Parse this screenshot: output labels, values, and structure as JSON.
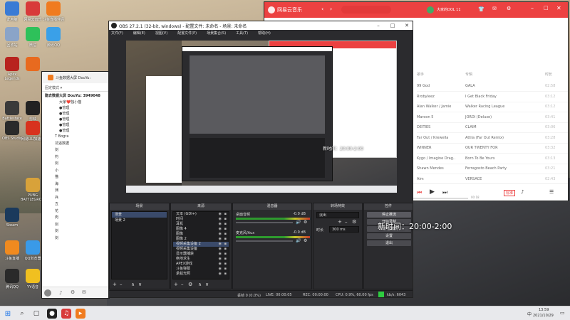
{
  "desktop": {
    "icons": [
      {
        "label": "此电脑",
        "icon": "computer-icon",
        "color": "#3a7bd5"
      },
      {
        "label": "网易云音乐",
        "icon": "netease-music-icon",
        "color": "#d83a3a"
      },
      {
        "label": "斗鱼直播伴侣",
        "icon": "douyu-icon",
        "color": "#f07b1f"
      },
      {
        "label": "回收站",
        "icon": "recycle-bin-icon",
        "color": "#8aa4c8"
      },
      {
        "label": "微信",
        "icon": "wechat-icon",
        "color": "#2ec15a"
      },
      {
        "label": "腾讯QQ",
        "icon": "qq-icon",
        "color": "#3aa0e8"
      },
      {
        "label": "Apex Legends",
        "icon": "apex-icon",
        "color": "#b8231e"
      },
      {
        "label": "",
        "icon": "app-icon",
        "color": "#e86a1f"
      },
      {
        "label": "Battlestate Games",
        "icon": "battlestate-icon",
        "color": "#3a3a3a"
      },
      {
        "label": "剪映",
        "icon": "jianying-icon",
        "color": "#222"
      },
      {
        "label": "OBS Studio",
        "icon": "obs-icon",
        "color": "#2a2a2a"
      },
      {
        "label": "网易UU加速器",
        "icon": "uu-icon",
        "color": "#d8321e"
      },
      {
        "label": "PUBG BATTLEGROUNDS",
        "icon": "pubg-icon",
        "color": "#d8a23a"
      },
      {
        "label": "Steam",
        "icon": "steam-icon",
        "color": "#1b3a5c"
      },
      {
        "label": "斗鱼直播",
        "icon": "douyu-live-icon",
        "color": "#f08a1f"
      },
      {
        "label": "QQ浏览器",
        "icon": "qq-browser-icon",
        "color": "#3a9ae8"
      },
      {
        "label": "腾讯QQ",
        "icon": "tencent-qq-icon",
        "color": "#2a2a2a"
      },
      {
        "label": "YY语音",
        "icon": "yy-icon",
        "color": "#f0c020"
      }
    ]
  },
  "douyu": {
    "title": "斗鱼数据大屏 DouYu:",
    "room_line": "隐去数据大屏 DouYu: 3949048",
    "items": [
      "大家❤️独小猫",
      "●管理",
      "●管理",
      "●管理",
      "●管理",
      "●管理"
    ],
    "list": [
      "T Bogra",
      "坑逼数据",
      "剑",
      "钓",
      "剑",
      "小",
      "猫",
      "海",
      "渊",
      "兵",
      "五",
      "花",
      "肉",
      "剑",
      "剑",
      "剑"
    ],
    "links": [
      "问问",
      "问问",
      "问问",
      "问问"
    ]
  },
  "obs": {
    "title": "OBS 27.2.1 (32-bit, windows) - 配置文件: 未命名 - 场景: 未命名",
    "menu": [
      "文件(F)",
      "编辑(E)",
      "视图(V)",
      "配置文件(P)",
      "场景集合(S)",
      "工具(T)",
      "帮助(H)"
    ],
    "scenes_header": "场景",
    "scenes": [
      "场景",
      "场景 2"
    ],
    "sources_header": "来源",
    "sources": [
      "文本 (GDI+)",
      "时间",
      "耳机",
      "图像 4",
      "图像",
      "图像 2",
      "视频采集设备 2",
      "视频采集设备",
      "显示器捕获",
      "绝地求生",
      "APEX游戏",
      "斗鱼弹幕",
      "承载光照"
    ],
    "mixer_header": "混音器",
    "mixer": [
      {
        "name": "桌面音频",
        "db": "-0.0 dB"
      },
      {
        "name": "麦克风/Aux",
        "db": "-0.0 dB"
      }
    ],
    "transitions_header": "转场特效",
    "transition": "淡出",
    "duration_label": "时长",
    "duration_value": "300 ms",
    "controls_header": "控件",
    "controls": [
      "停止推流",
      "开始录制",
      "工作室模式",
      "设置",
      "退出"
    ],
    "status": {
      "dropped": "丢帧 0 (0.0%)",
      "live": "LIVE: 00:00:05",
      "rec": "REC: 00:00:00",
      "cpu": "CPU: 0.9%, 60.00 fps",
      "kbps": "kb/s: 6043"
    }
  },
  "overlay_time": "新时间：20:00-2:00",
  "music": {
    "title": "网易云音乐",
    "user": "大家的DOL 11",
    "cols": [
      "歌手",
      "专辑",
      "时长"
    ],
    "rows": [
      {
        "song": "99 God",
        "artist": "",
        "album": "GALA",
        "dur": "02:58"
      },
      {
        "song": "",
        "artist": "Rrobyleez",
        "album": "I Get Black Friday",
        "dur": "03:12"
      },
      {
        "song": "",
        "artist": "Alan Walker / Jamie",
        "album": "Walker Racing League",
        "dur": "03:12"
      },
      {
        "song": "",
        "artist": "Maroon 5",
        "album": "JORDI (Deluxe)",
        "dur": "03:41"
      },
      {
        "song": "",
        "artist": "DEITIES",
        "album": "CLAIM",
        "dur": "03:06"
      },
      {
        "song": "",
        "artist": "Far Out / Krewella",
        "album": "Attila (Far Out Remix)",
        "dur": "03:28"
      },
      {
        "song": "",
        "artist": "WINNER",
        "album": "OUR TWENTY FOR",
        "dur": "03:32"
      },
      {
        "song": "",
        "artist": "Kygo / Imagine Drag..",
        "album": "Born To Be Yours",
        "dur": "03:13"
      },
      {
        "song": "",
        "artist": "Shawn Mendes",
        "album": "Ferragosto Beach Party",
        "dur": "03:21"
      },
      {
        "song": "",
        "artist": "Aim",
        "album": "VERSACE",
        "dur": "02:43"
      }
    ],
    "progress_time": "00:18",
    "tag": "标准"
  },
  "taskbar": {
    "time": "13:59",
    "date": "2021/10/29",
    "lang": "中"
  }
}
